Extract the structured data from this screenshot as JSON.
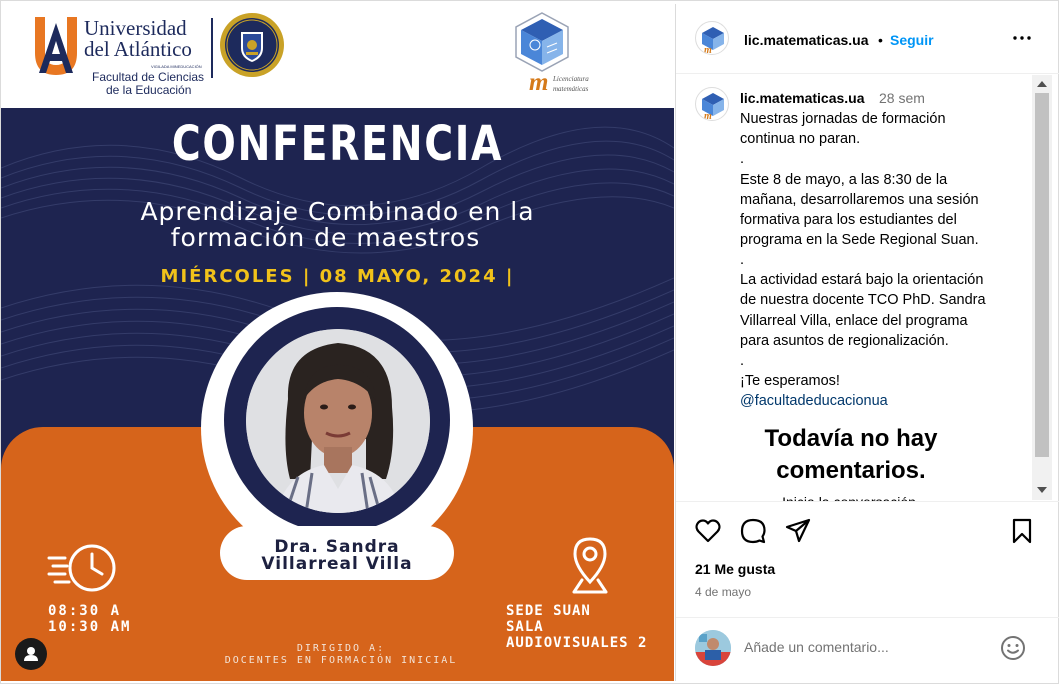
{
  "poster": {
    "university_line1": "Universidad",
    "university_line2": "del Atlántico",
    "university_vig": "VIGILADA MINEDUCACIÓN",
    "faculty_line1": "Facultad de Ciencias",
    "faculty_line2": "de la Educación",
    "lm_line1": "Licenciatura",
    "lm_line2": "matemáticas",
    "lm_letter": "m",
    "title": "CONFERENCIA",
    "subtitle_line1": "Aprendizaje Combinado en la",
    "subtitle_line2": "formación de maestros",
    "date": "MIÉRCOLES | 08 MAYO, 2024 |",
    "speaker_line1": "Dra. Sandra",
    "speaker_line2": "Villarreal Villa",
    "time_line1": "08:30 A",
    "time_line2": "10:30 AM",
    "location_line1": "SEDE SUAN",
    "location_line2": "SALA",
    "location_line3": "AUDIOVISUALES 2",
    "directed_line1": "DIRIGIDO A:",
    "directed_line2": "DOCENTES EN FORMACIÓN INICIAL",
    "colors": {
      "navy": "#1e2450",
      "orange": "#d6641b",
      "gold": "#f1c21a"
    }
  },
  "header": {
    "username": "lic.matematicas.ua",
    "dot": "•",
    "follow_label": "Seguir",
    "more_icon": "more-horizontal-icon"
  },
  "caption": {
    "username": "lic.matematicas.ua",
    "time_ago": "28 sem",
    "lines": [
      "Nuestras jornadas de formación",
      "continua no paran.",
      ".",
      "Este 8 de mayo, a las 8:30 de la",
      "mañana, desarrollaremos una sesión",
      "formativa para los estudiantes del",
      "programa en la Sede Regional Suan.",
      ".",
      "La actividad estará bajo la orientación",
      "de nuestra docente TCO PhD. Sandra",
      "Villarreal Villa, enlace del programa",
      "para asuntos de regionalización.",
      ".",
      "¡Te esperamos!"
    ],
    "mention": "@facultadeducacionua"
  },
  "comments": {
    "empty_line1": "Todavía no hay",
    "empty_line2": "comentarios.",
    "start_conversation": "Inicia la conversación."
  },
  "actions": {
    "likes": "21 Me gusta",
    "date": "4 de mayo",
    "icons": [
      "heart-icon",
      "comment-icon",
      "share-icon",
      "bookmark-icon"
    ]
  },
  "comment_bar": {
    "placeholder": "Añade un comentario...",
    "emoji_icon": "emoji-icon"
  }
}
